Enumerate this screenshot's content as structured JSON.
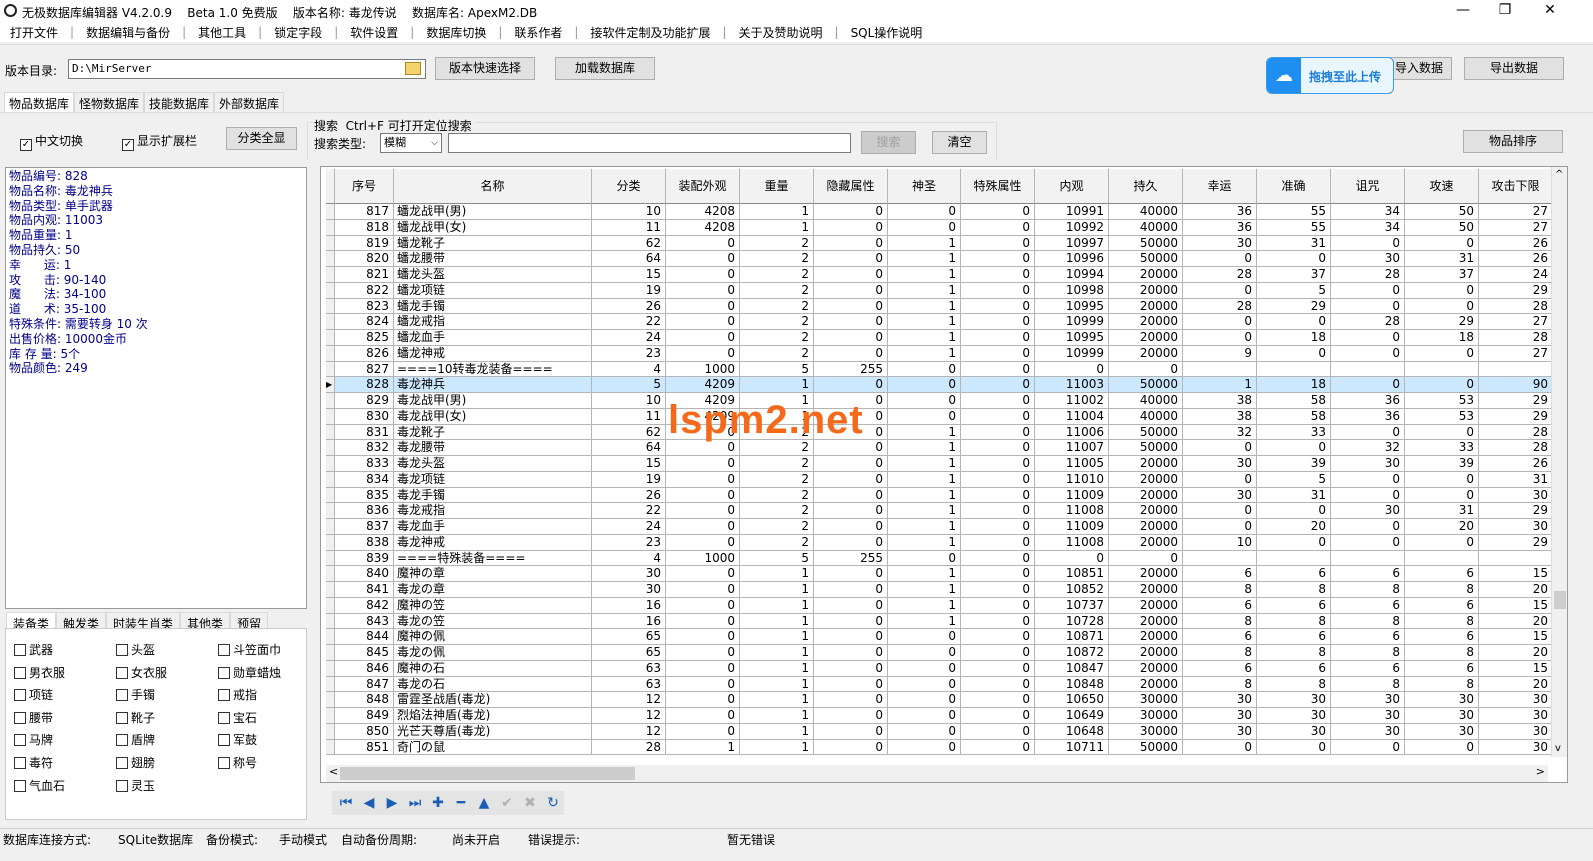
{
  "title": {
    "app": "无极数据库编辑器 V4.2.0.9    Beta 1.0 免费版    版本名称: 毒龙传说    数据库名: ApexM2.DB",
    "minimize": "—",
    "maximize": "❐",
    "close": "✕"
  },
  "menu": [
    "打开文件",
    "数据编辑与备份",
    "其他工具",
    "锁定字段",
    "软件设置",
    "数据库切换",
    "联系作者",
    "接软件定制及功能扩展",
    "关于及赞助说明",
    "SQL操作说明"
  ],
  "toolbar": {
    "dir_label": "版本目录:",
    "dir_value": "D:\\MirServer",
    "quick_select": "版本快速选择",
    "load_db": "加载数据库",
    "import": "导入数据",
    "export": "导出数据",
    "upload": "拖拽至此上传"
  },
  "db_tabs": [
    "物品数据库",
    "怪物数据库",
    "技能数据库",
    "外部数据库"
  ],
  "options": {
    "chinese": "中文切换",
    "show_ext": "显示扩展栏",
    "show_all": "分类全显",
    "search_title": "搜索  Ctrl+F 可打开定位搜索",
    "search_type_label": "搜索类型:",
    "search_type": "模糊",
    "search_value": "",
    "search_btn": "搜索",
    "clear_btn": "清空",
    "sort_btn": "物品排序"
  },
  "info": [
    "物品编号: 828",
    "物品名称: 毒龙神兵",
    "物品类型: 单手武器",
    "物品内观: 11003",
    "物品重量: 1",
    "物品持久: 50",
    "幸      运: 1",
    "攻      击: 90-140",
    "魔      法: 34-100",
    "道      术: 35-100",
    "特殊条件: 需要转身 10 次",
    "出售价格: 10000金币",
    "库 存 量: 5个",
    "物品颜色: 249"
  ],
  "cat_tabs": [
    "装备类",
    "触发类",
    "时装生肖类",
    "其他类",
    "预留"
  ],
  "cat_checks": [
    "武器",
    "头盔",
    "斗笠面巾",
    "男衣服",
    "女衣服",
    "勋章蜡烛",
    "项链",
    "手镯",
    "戒指",
    "腰带",
    "靴子",
    "宝石",
    "马牌",
    "盾牌",
    "军鼓",
    "毒符",
    "翅膀",
    "称号",
    "气血石",
    "灵玉"
  ],
  "table": {
    "columns": [
      "序号",
      "名称",
      "分类",
      "装配外观",
      "重量",
      "隐藏属性",
      "神圣",
      "特殊属性",
      "内观",
      "持久",
      "幸运",
      "准确",
      "诅咒",
      "攻速",
      "攻击下限"
    ],
    "selected": "828",
    "rows": [
      [
        "817",
        "蟠龙战甲(男)",
        "10",
        "4208",
        "1",
        "0",
        "0",
        "0",
        "10991",
        "40000",
        "36",
        "55",
        "34",
        "50",
        "27"
      ],
      [
        "818",
        "蟠龙战甲(女)",
        "11",
        "4208",
        "1",
        "0",
        "0",
        "0",
        "10992",
        "40000",
        "36",
        "55",
        "34",
        "50",
        "27"
      ],
      [
        "819",
        "蟠龙靴子",
        "62",
        "0",
        "2",
        "0",
        "1",
        "0",
        "10997",
        "50000",
        "30",
        "31",
        "0",
        "0",
        "26"
      ],
      [
        "820",
        "蟠龙腰带",
        "64",
        "0",
        "2",
        "0",
        "1",
        "0",
        "10996",
        "50000",
        "0",
        "0",
        "30",
        "31",
        "26"
      ],
      [
        "821",
        "蟠龙头盔",
        "15",
        "0",
        "2",
        "0",
        "1",
        "0",
        "10994",
        "20000",
        "28",
        "37",
        "28",
        "37",
        "24"
      ],
      [
        "822",
        "蟠龙项链",
        "19",
        "0",
        "2",
        "0",
        "1",
        "0",
        "10998",
        "20000",
        "0",
        "5",
        "0",
        "0",
        "29"
      ],
      [
        "823",
        "蟠龙手镯",
        "26",
        "0",
        "2",
        "0",
        "1",
        "0",
        "10995",
        "20000",
        "28",
        "29",
        "0",
        "0",
        "28"
      ],
      [
        "824",
        "蟠龙戒指",
        "22",
        "0",
        "2",
        "0",
        "1",
        "0",
        "10999",
        "20000",
        "0",
        "0",
        "28",
        "29",
        "27"
      ],
      [
        "825",
        "蟠龙血手",
        "24",
        "0",
        "2",
        "0",
        "1",
        "0",
        "10995",
        "20000",
        "0",
        "18",
        "0",
        "18",
        "28"
      ],
      [
        "826",
        "蟠龙神戒",
        "23",
        "0",
        "2",
        "0",
        "1",
        "0",
        "10999",
        "20000",
        "9",
        "0",
        "0",
        "0",
        "27"
      ],
      [
        "827",
        "====10转毒龙装备====",
        "4",
        "1000",
        "5",
        "255",
        "0",
        "0",
        "0",
        "0",
        "",
        "",
        "",
        "",
        ""
      ],
      [
        "828",
        "毒龙神兵",
        "5",
        "4209",
        "1",
        "0",
        "0",
        "0",
        "11003",
        "50000",
        "1",
        "18",
        "0",
        "0",
        "90"
      ],
      [
        "829",
        "毒龙战甲(男)",
        "10",
        "4209",
        "1",
        "0",
        "0",
        "0",
        "11002",
        "40000",
        "38",
        "58",
        "36",
        "53",
        "29"
      ],
      [
        "830",
        "毒龙战甲(女)",
        "11",
        "4209",
        "1",
        "0",
        "0",
        "0",
        "11004",
        "40000",
        "38",
        "58",
        "36",
        "53",
        "29"
      ],
      [
        "831",
        "毒龙靴子",
        "62",
        "0",
        "2",
        "0",
        "1",
        "0",
        "11006",
        "50000",
        "32",
        "33",
        "0",
        "0",
        "28"
      ],
      [
        "832",
        "毒龙腰带",
        "64",
        "0",
        "2",
        "0",
        "1",
        "0",
        "11007",
        "50000",
        "0",
        "0",
        "32",
        "33",
        "28"
      ],
      [
        "833",
        "毒龙头盔",
        "15",
        "0",
        "2",
        "0",
        "1",
        "0",
        "11005",
        "20000",
        "30",
        "39",
        "30",
        "39",
        "26"
      ],
      [
        "834",
        "毒龙项链",
        "19",
        "0",
        "2",
        "0",
        "1",
        "0",
        "11010",
        "20000",
        "0",
        "5",
        "0",
        "0",
        "31"
      ],
      [
        "835",
        "毒龙手镯",
        "26",
        "0",
        "2",
        "0",
        "1",
        "0",
        "11009",
        "20000",
        "30",
        "31",
        "0",
        "0",
        "30"
      ],
      [
        "836",
        "毒龙戒指",
        "22",
        "0",
        "2",
        "0",
        "1",
        "0",
        "11008",
        "20000",
        "0",
        "0",
        "30",
        "31",
        "29"
      ],
      [
        "837",
        "毒龙血手",
        "24",
        "0",
        "2",
        "0",
        "1",
        "0",
        "11009",
        "20000",
        "0",
        "20",
        "0",
        "20",
        "30"
      ],
      [
        "838",
        "毒龙神戒",
        "23",
        "0",
        "2",
        "0",
        "1",
        "0",
        "11008",
        "20000",
        "10",
        "0",
        "0",
        "0",
        "29"
      ],
      [
        "839",
        "====特殊装备====",
        "4",
        "1000",
        "5",
        "255",
        "0",
        "0",
        "0",
        "0",
        "",
        "",
        "",
        "",
        ""
      ],
      [
        "840",
        "魔神の章",
        "30",
        "0",
        "1",
        "0",
        "1",
        "0",
        "10851",
        "20000",
        "6",
        "6",
        "6",
        "6",
        "15"
      ],
      [
        "841",
        "毒龙の章",
        "30",
        "0",
        "1",
        "0",
        "1",
        "0",
        "10852",
        "20000",
        "8",
        "8",
        "8",
        "8",
        "20"
      ],
      [
        "842",
        "魔神の笠",
        "16",
        "0",
        "1",
        "0",
        "1",
        "0",
        "10737",
        "20000",
        "6",
        "6",
        "6",
        "6",
        "15"
      ],
      [
        "843",
        "毒龙の笠",
        "16",
        "0",
        "1",
        "0",
        "1",
        "0",
        "10728",
        "20000",
        "8",
        "8",
        "8",
        "8",
        "20"
      ],
      [
        "844",
        "魔神の佩",
        "65",
        "0",
        "1",
        "0",
        "0",
        "0",
        "10871",
        "20000",
        "6",
        "6",
        "6",
        "6",
        "15"
      ],
      [
        "845",
        "毒龙の佩",
        "65",
        "0",
        "1",
        "0",
        "0",
        "0",
        "10872",
        "20000",
        "8",
        "8",
        "8",
        "8",
        "20"
      ],
      [
        "846",
        "魔神の石",
        "63",
        "0",
        "1",
        "0",
        "0",
        "0",
        "10847",
        "20000",
        "6",
        "6",
        "6",
        "6",
        "15"
      ],
      [
        "847",
        "毒龙の石",
        "63",
        "0",
        "1",
        "0",
        "0",
        "0",
        "10848",
        "20000",
        "8",
        "8",
        "8",
        "8",
        "20"
      ],
      [
        "848",
        "雷霆圣战盾(毒龙)",
        "12",
        "0",
        "1",
        "0",
        "0",
        "0",
        "10650",
        "30000",
        "30",
        "30",
        "30",
        "30",
        "30"
      ],
      [
        "849",
        "烈焰法神盾(毒龙)",
        "12",
        "0",
        "1",
        "0",
        "0",
        "0",
        "10649",
        "30000",
        "30",
        "30",
        "30",
        "30",
        "30"
      ],
      [
        "850",
        "光芒天尊盾(毒龙)",
        "12",
        "0",
        "1",
        "0",
        "0",
        "0",
        "10648",
        "30000",
        "30",
        "30",
        "30",
        "30",
        "30"
      ],
      [
        "851",
        "奇门の鼠",
        "28",
        "1",
        "1",
        "0",
        "0",
        "0",
        "10711",
        "50000",
        "0",
        "0",
        "0",
        "0",
        "30"
      ]
    ]
  },
  "watermark": "lspm2.net",
  "status": {
    "conn_label": "数据库连接方式:",
    "conn": "SQLite数据库",
    "backup_label": "备份模式:",
    "backup": "手动模式",
    "auto_label": "自动备份周期:",
    "auto": "尚未开启",
    "err_label": "错误提示:",
    "err": "暂无错误"
  },
  "colors": {
    "selected_row": "#cce8ff",
    "info_text": "#00008b",
    "watermark": "#f56a1a",
    "nav_icons": "#1a5fb4"
  }
}
